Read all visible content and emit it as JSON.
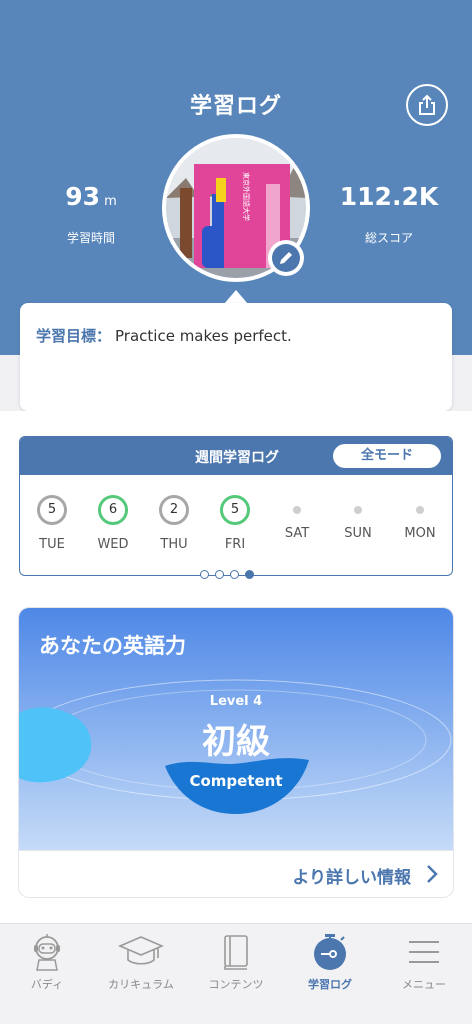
{
  "header": {
    "title": "学習ログ",
    "study_time": {
      "value": "93",
      "unit": "m",
      "label": "学習時間"
    },
    "total_score": {
      "value": "112.2K",
      "label": "総スコア"
    },
    "icons": {
      "share": "share-icon",
      "edit": "pencil-icon"
    },
    "avatar_sign_text": "東京外国語大学"
  },
  "goal": {
    "label": "学習目標：",
    "text": "Practice makes perfect."
  },
  "weekly_log": {
    "title": "週間学習ログ",
    "mode_button": "全モード",
    "days": [
      {
        "label": "TUE",
        "count": "5",
        "status": "gray"
      },
      {
        "label": "WED",
        "count": "6",
        "status": "green"
      },
      {
        "label": "THU",
        "count": "2",
        "status": "gray"
      },
      {
        "label": "FRI",
        "count": "5",
        "status": "green"
      },
      {
        "label": "SAT",
        "count": "",
        "status": "none"
      },
      {
        "label": "SUN",
        "count": "",
        "status": "none"
      },
      {
        "label": "MON",
        "count": "",
        "status": "none"
      }
    ],
    "pager": {
      "pages": 4,
      "current": 4
    }
  },
  "english_level": {
    "title": "あなたの英語力",
    "level_label": "Level 4",
    "level_name": "初級",
    "level_english": "Competent",
    "more_link": "より詳しい情報"
  },
  "tabbar": {
    "items": [
      {
        "label": "バディ",
        "icon": "robot-icon",
        "active": false
      },
      {
        "label": "カリキュラム",
        "icon": "graduation-cap-icon",
        "active": false
      },
      {
        "label": "コンテンツ",
        "icon": "book-icon",
        "active": false
      },
      {
        "label": "学習ログ",
        "icon": "stopwatch-icon",
        "active": true
      },
      {
        "label": "メニュー",
        "icon": "menu-icon",
        "active": false
      }
    ]
  },
  "colors": {
    "header_blue": "#5886bb",
    "accent_blue": "#4b76ae",
    "ring_green": "#55c97a",
    "ring_gray": "#a7a7a7"
  }
}
